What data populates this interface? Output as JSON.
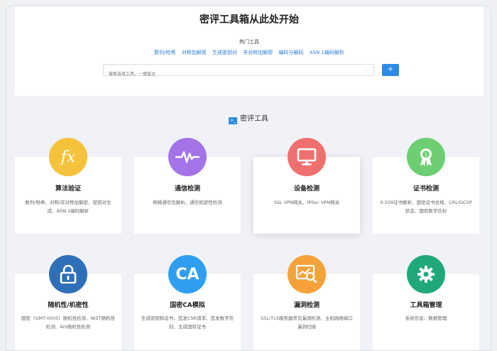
{
  "hero": {
    "title": "密评工具箱从此处开始",
    "hot_label": "热门工具",
    "hot_links": [
      "数列/哈希",
      "对称加解密",
      "生成密钥对",
      "非对称加解密",
      "编码与解码",
      "ASN.1编码解析"
    ],
    "search_placeholder": "搜索选择工具，一键直达",
    "search_button": "+"
  },
  "section": {
    "title": "密评工具",
    "icon": "terminal-icon"
  },
  "cards": [
    {
      "name": "algorithm-verify",
      "title": "算法验证",
      "desc": "数列/哈希、对称/非对称加解密、密钥对生成、ASN.1编码解析",
      "icon": "fx-icon",
      "color": "#f5c23b"
    },
    {
      "name": "comm-detect",
      "title": "通信检测",
      "desc": "网络通信包解析、通信机密性检测",
      "icon": "waveform-icon",
      "color": "#a374e8"
    },
    {
      "name": "device-detect",
      "title": "设备检测",
      "desc": "SSL VPN网关、IPSec VPN网关",
      "icon": "monitor-icon",
      "color": "#f0706f"
    },
    {
      "name": "cert-detect",
      "title": "证书检测",
      "desc": "X.509证书解析、国密证书合规、CRL/OCSP状态、国密数字信封",
      "icon": "certificate-icon",
      "color": "#6dce73"
    },
    {
      "name": "randomness",
      "title": "随机性/机密性",
      "desc": "国密（GMT-0005）随机性检测、NIST随机性检测、AIS随机性检测",
      "icon": "lock-icon",
      "color": "#2f6fb8"
    },
    {
      "name": "gm-ca",
      "title": "国密CA模拟",
      "desc": "生成密钥和证书、签发CSR请求、签发数字信封、生成国际证书",
      "icon": "ca-text",
      "color": "#2f9ef0"
    },
    {
      "name": "vuln-detect",
      "title": "漏洞检测",
      "desc": "SSL/TLS服务器常见漏洞检测、主机网络端口漏洞扫描",
      "icon": "chart-magnifier-icon",
      "color": "#f5a23b"
    },
    {
      "name": "toolbox-manage",
      "title": "工具箱管理",
      "desc": "系统信息、数据管理",
      "icon": "gear-icon",
      "color": "#21a87a"
    }
  ]
}
